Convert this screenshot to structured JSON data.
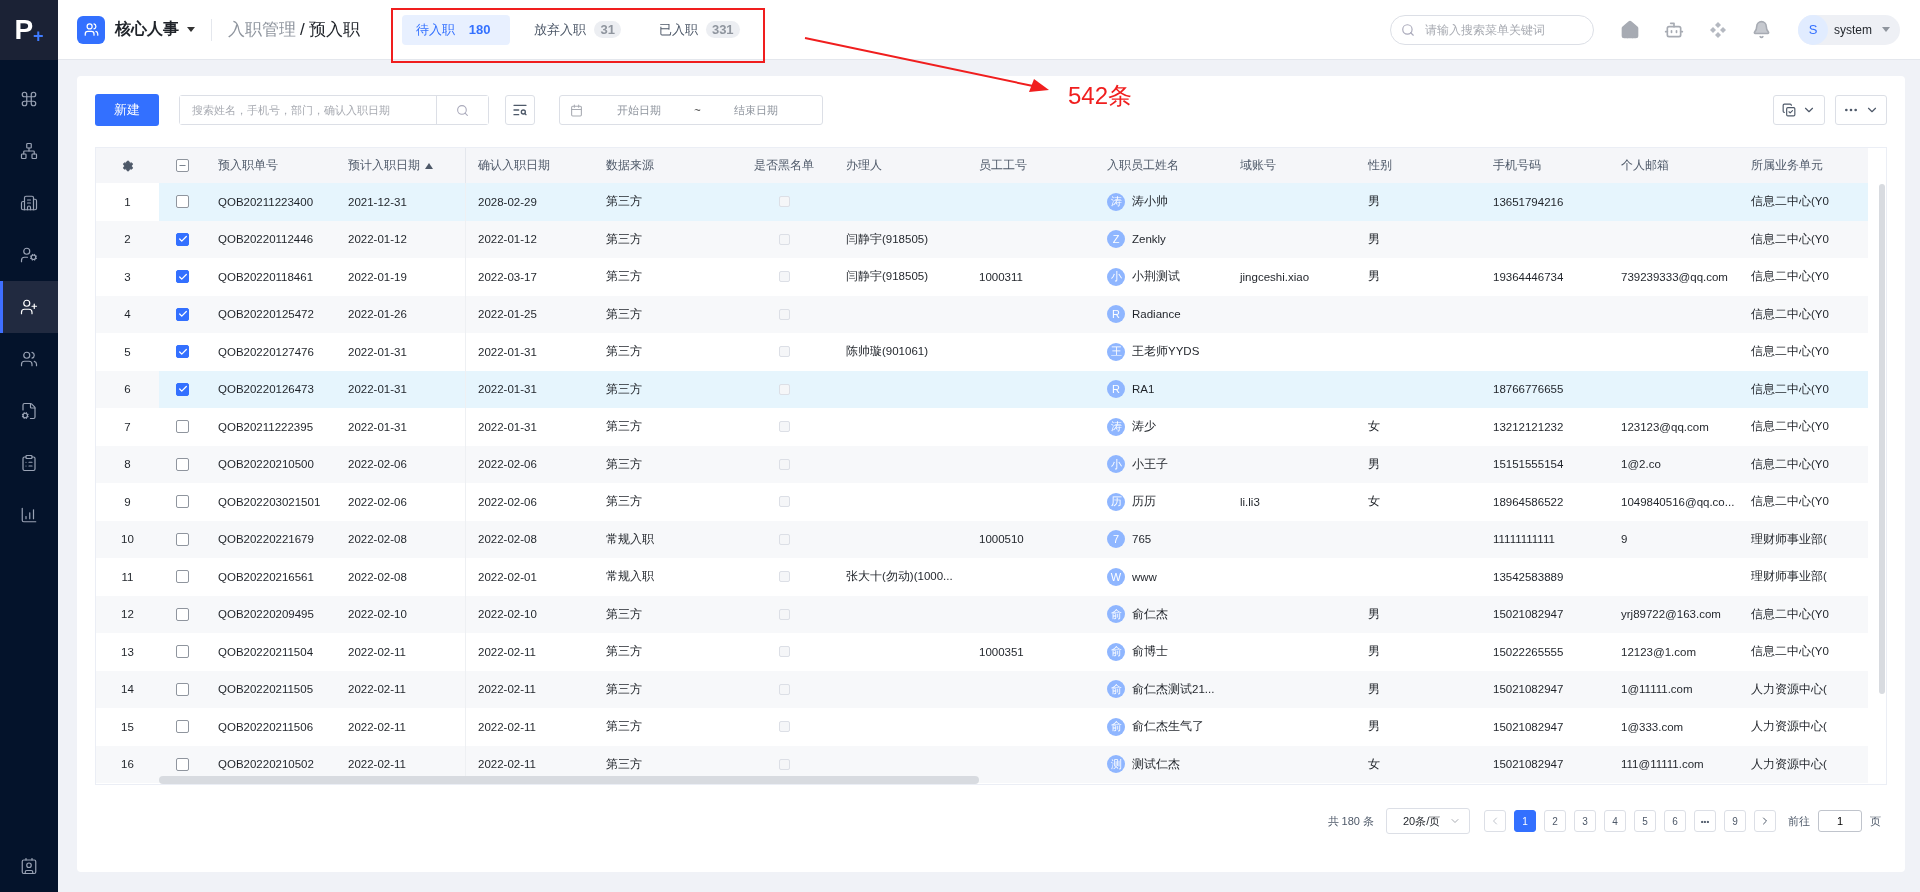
{
  "logo": {
    "letter": "P",
    "mark": "+"
  },
  "app": {
    "name": "核心人事"
  },
  "breadcrumb": {
    "items": [
      "入职管理",
      "预入职"
    ],
    "separator": "/"
  },
  "tabs": [
    {
      "label": "待入职",
      "count": "180",
      "selected": true
    },
    {
      "label": "放弃入职",
      "count": "31",
      "selected": false
    },
    {
      "label": "已入职",
      "count": "331",
      "selected": false
    }
  ],
  "search": {
    "placeholder": "请输入搜索菜单关键词"
  },
  "user": {
    "avatar": "S",
    "name": "system"
  },
  "sidebar": {
    "items": [
      {
        "selected": false
      },
      {
        "selected": false
      },
      {
        "selected": false
      },
      {
        "selected": false
      },
      {
        "selected": true
      },
      {
        "selected": false
      },
      {
        "selected": false
      },
      {
        "selected": false
      },
      {
        "selected": false
      }
    ]
  },
  "toolbar": {
    "new_button": "新建",
    "search_placeholder": "搜索姓名，手机号，部门，确认入职日期",
    "date_start": "开始日期",
    "date_sep": "~",
    "date_end": "结束日期"
  },
  "table": {
    "select_all": {
      "indeterminate": true
    },
    "columns": [
      {
        "label": "预入职单号",
        "sorted": false
      },
      {
        "label": "预计入职日期",
        "sorted": true
      },
      {
        "label": "确认入职日期",
        "sorted": false
      },
      {
        "label": "数据来源",
        "sorted": false
      },
      {
        "label": "是否黑名单",
        "sorted": false
      },
      {
        "label": "办理人",
        "sorted": false
      },
      {
        "label": "员工工号",
        "sorted": false
      },
      {
        "label": "入职员工姓名",
        "sorted": false
      },
      {
        "label": "域账号",
        "sorted": false
      },
      {
        "label": "性别",
        "sorted": false
      },
      {
        "label": "手机号码",
        "sorted": false
      },
      {
        "label": "个人邮箱",
        "sorted": false
      },
      {
        "label": "所属业务单元",
        "sorted": false
      }
    ],
    "rows": [
      {
        "no": "1",
        "checked": false,
        "selected": true,
        "code": "QOB20211223400",
        "planned": "2021-12-31",
        "confirmed": "2028-02-29",
        "source": "第三方",
        "blacklisted": false,
        "handler": "",
        "employee_no": "",
        "avatar": "涛",
        "name": "涛小帅",
        "domain": "",
        "gender": "男",
        "phone": "13651794216",
        "email": "",
        "unit": "信息二中心(Y0"
      },
      {
        "no": "2",
        "checked": true,
        "selected": false,
        "code": "QOB20220112446",
        "planned": "2022-01-12",
        "confirmed": "2022-01-12",
        "source": "第三方",
        "blacklisted": false,
        "handler": "闫静宇(918505)",
        "employee_no": "",
        "avatar": "Z",
        "name": "Zenkly",
        "domain": "",
        "gender": "男",
        "phone": "",
        "email": "",
        "unit": "信息二中心(Y0"
      },
      {
        "no": "3",
        "checked": true,
        "selected": false,
        "code": "QOB20220118461",
        "planned": "2022-01-19",
        "confirmed": "2022-03-17",
        "source": "第三方",
        "blacklisted": false,
        "handler": "闫静宇(918505)",
        "employee_no": "1000311",
        "avatar": "小",
        "name": "小荆测试",
        "domain": "jingceshi.xiao",
        "gender": "男",
        "phone": "19364446734",
        "email": "739239333@qq.com",
        "unit": "信息二中心(Y0"
      },
      {
        "no": "4",
        "checked": true,
        "selected": false,
        "code": "QOB20220125472",
        "planned": "2022-01-26",
        "confirmed": "2022-01-25",
        "source": "第三方",
        "blacklisted": false,
        "handler": "",
        "employee_no": "",
        "avatar": "R",
        "name": "Radiance",
        "domain": "",
        "gender": "",
        "phone": "",
        "email": "",
        "unit": "信息二中心(Y0"
      },
      {
        "no": "5",
        "checked": true,
        "selected": false,
        "code": "QOB20220127476",
        "planned": "2022-01-31",
        "confirmed": "2022-01-31",
        "source": "第三方",
        "blacklisted": false,
        "handler": "陈帅璇(901061)",
        "employee_no": "",
        "avatar": "王",
        "name": "王老师YYDS",
        "domain": "",
        "gender": "",
        "phone": "",
        "email": "",
        "unit": "信息二中心(Y0"
      },
      {
        "no": "6",
        "checked": true,
        "selected": true,
        "code": "QOB20220126473",
        "planned": "2022-01-31",
        "confirmed": "2022-01-31",
        "source": "第三方",
        "blacklisted": false,
        "handler": "",
        "employee_no": "",
        "avatar": "R",
        "name": "RA1",
        "domain": "",
        "gender": "",
        "phone": "18766776655",
        "email": "",
        "unit": "信息二中心(Y0"
      },
      {
        "no": "7",
        "checked": false,
        "selected": false,
        "code": "QOB20211222395",
        "planned": "2022-01-31",
        "confirmed": "2022-01-31",
        "source": "第三方",
        "blacklisted": false,
        "handler": "",
        "employee_no": "",
        "avatar": "涛",
        "name": "涛少",
        "domain": "",
        "gender": "女",
        "phone": "13212121232",
        "email": "123123@qq.com",
        "unit": "信息二中心(Y0"
      },
      {
        "no": "8",
        "checked": false,
        "selected": false,
        "code": "QOB20220210500",
        "planned": "2022-02-06",
        "confirmed": "2022-02-06",
        "source": "第三方",
        "blacklisted": false,
        "handler": "",
        "employee_no": "",
        "avatar": "小",
        "name": "小王子",
        "domain": "",
        "gender": "男",
        "phone": "15151555154",
        "email": "1@2.co",
        "unit": "信息二中心(Y0"
      },
      {
        "no": "9",
        "checked": false,
        "selected": false,
        "code": "QOB202203021501",
        "planned": "2022-02-06",
        "confirmed": "2022-02-06",
        "source": "第三方",
        "blacklisted": false,
        "handler": "",
        "employee_no": "",
        "avatar": "历",
        "name": "历历",
        "domain": "li.li3",
        "gender": "女",
        "phone": "18964586522",
        "email": "1049840516@qq.co...",
        "unit": "信息二中心(Y0"
      },
      {
        "no": "10",
        "checked": false,
        "selected": false,
        "code": "QOB20220221679",
        "planned": "2022-02-08",
        "confirmed": "2022-02-08",
        "source": "常规入职",
        "blacklisted": false,
        "handler": "",
        "employee_no": "1000510",
        "avatar": "7",
        "name": "765",
        "domain": "",
        "gender": "",
        "phone": "11111111111",
        "email": "9",
        "unit": "理财师事业部("
      },
      {
        "no": "11",
        "checked": false,
        "selected": false,
        "code": "QOB20220216561",
        "planned": "2022-02-08",
        "confirmed": "2022-02-01",
        "source": "常规入职",
        "blacklisted": false,
        "handler": "张大十(勿动)(1000...",
        "employee_no": "",
        "avatar": "W",
        "name": "www",
        "domain": "",
        "gender": "",
        "phone": "13542583889",
        "email": "",
        "unit": "理财师事业部("
      },
      {
        "no": "12",
        "checked": false,
        "selected": false,
        "code": "QOB20220209495",
        "planned": "2022-02-10",
        "confirmed": "2022-02-10",
        "source": "第三方",
        "blacklisted": false,
        "handler": "",
        "employee_no": "",
        "avatar": "俞",
        "name": "俞仁杰",
        "domain": "",
        "gender": "男",
        "phone": "15021082947",
        "email": "yrj89722@163.com",
        "unit": "信息二中心(Y0"
      },
      {
        "no": "13",
        "checked": false,
        "selected": false,
        "code": "QOB20220211504",
        "planned": "2022-02-11",
        "confirmed": "2022-02-11",
        "source": "第三方",
        "blacklisted": false,
        "handler": "",
        "employee_no": "1000351",
        "avatar": "俞",
        "name": "俞博士",
        "domain": "",
        "gender": "男",
        "phone": "15022265555",
        "email": "12123@1.com",
        "unit": "信息二中心(Y0"
      },
      {
        "no": "14",
        "checked": false,
        "selected": false,
        "code": "QOB20220211505",
        "planned": "2022-02-11",
        "confirmed": "2022-02-11",
        "source": "第三方",
        "blacklisted": false,
        "handler": "",
        "employee_no": "",
        "avatar": "俞",
        "name": "俞仁杰测试21...",
        "domain": "",
        "gender": "男",
        "phone": "15021082947",
        "email": "1@11111.com",
        "unit": "人力资源中心("
      },
      {
        "no": "15",
        "checked": false,
        "selected": false,
        "code": "QOB20220211506",
        "planned": "2022-02-11",
        "confirmed": "2022-02-11",
        "source": "第三方",
        "blacklisted": false,
        "handler": "",
        "employee_no": "",
        "avatar": "俞",
        "name": "俞仁杰生气了",
        "domain": "",
        "gender": "男",
        "phone": "15021082947",
        "email": "1@333.com",
        "unit": "人力资源中心("
      },
      {
        "no": "16",
        "checked": false,
        "selected": false,
        "code": "QOB20220210502",
        "planned": "2022-02-11",
        "confirmed": "2022-02-11",
        "source": "第三方",
        "blacklisted": false,
        "handler": "",
        "employee_no": "",
        "avatar": "测",
        "name": "测试仁杰",
        "domain": "",
        "gender": "女",
        "phone": "15021082947",
        "email": "111@11111.com",
        "unit": "人力资源中心("
      }
    ]
  },
  "pagination": {
    "total": "共 180 条",
    "page_size": "20条/页",
    "pages": [
      {
        "label": "1",
        "kind": "page",
        "selected": true
      },
      {
        "label": "2",
        "kind": "page",
        "selected": false
      },
      {
        "label": "3",
        "kind": "page",
        "selected": false
      },
      {
        "label": "4",
        "kind": "page",
        "selected": false
      },
      {
        "label": "5",
        "kind": "page",
        "selected": false
      },
      {
        "label": "6",
        "kind": "page",
        "selected": false
      },
      {
        "label": "•••",
        "kind": "more",
        "selected": false
      },
      {
        "label": "9",
        "kind": "page",
        "selected": false
      }
    ],
    "goto_label": "前往",
    "goto_value": "1",
    "goto_suffix": "页"
  },
  "annotation": {
    "text": "542条"
  }
}
